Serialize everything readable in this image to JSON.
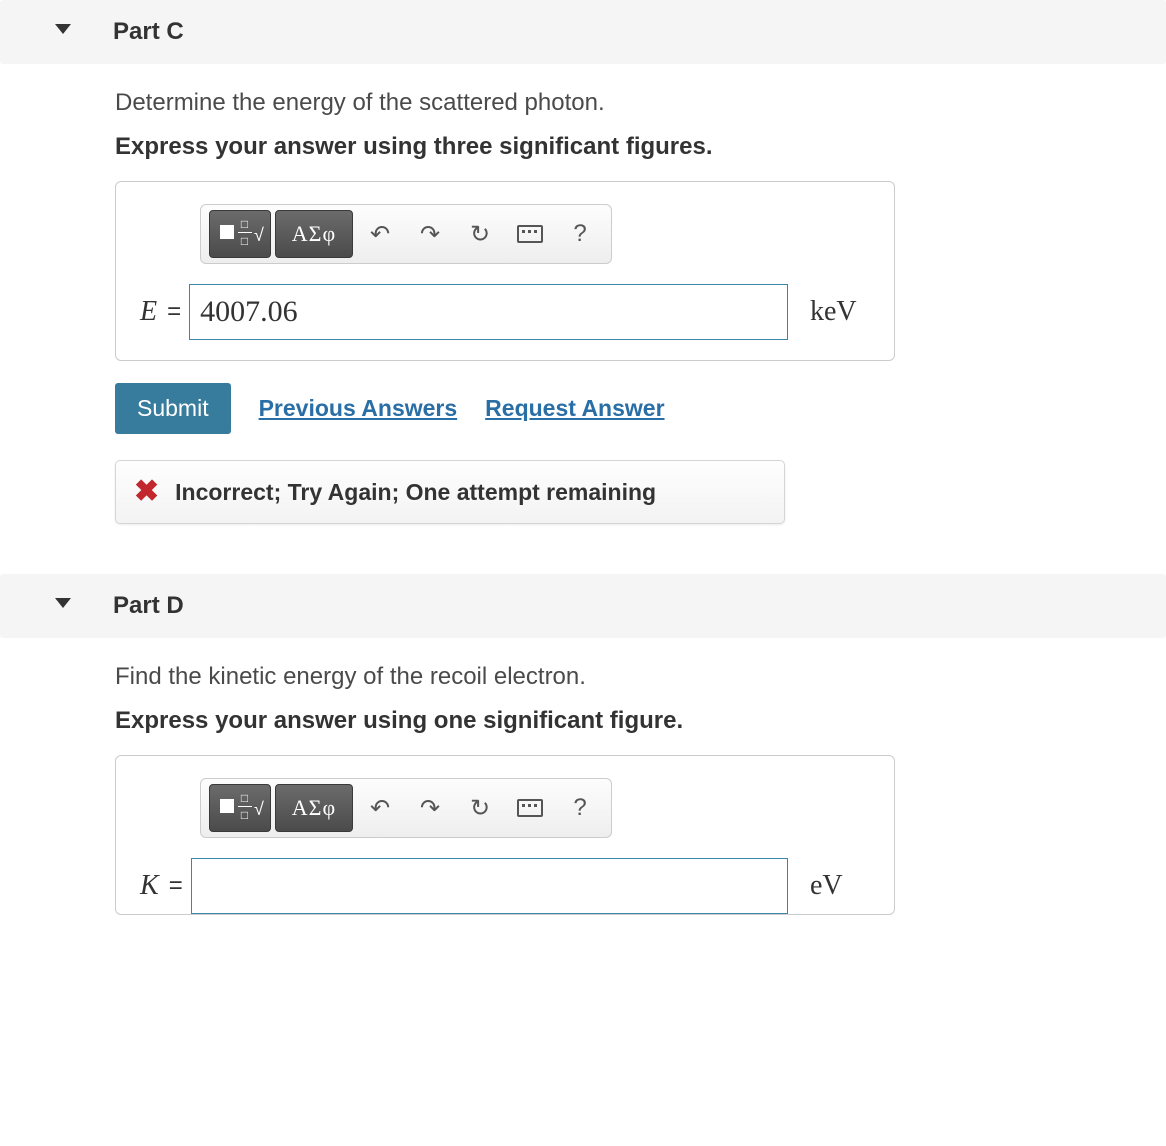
{
  "parts": [
    {
      "title": "Part C",
      "question": "Determine the energy of the scattered photon.",
      "instruction": "Express your answer using three significant figures.",
      "toolbar": {
        "greek": "ΑΣφ",
        "help": "?"
      },
      "answer": {
        "var": "E",
        "eq": "=",
        "value": "4007.06",
        "unit": "keV"
      },
      "actions": {
        "submit": "Submit",
        "prev": "Previous Answers",
        "request": "Request Answer"
      },
      "feedback": {
        "icon": "✖",
        "msg": "Incorrect; Try Again; One attempt remaining"
      }
    },
    {
      "title": "Part D",
      "question": "Find the kinetic energy of the recoil electron.",
      "instruction": "Express your answer using one significant figure.",
      "toolbar": {
        "greek": "ΑΣφ",
        "help": "?"
      },
      "answer": {
        "var": "K",
        "eq": "=",
        "value": "",
        "unit": "eV"
      }
    }
  ]
}
